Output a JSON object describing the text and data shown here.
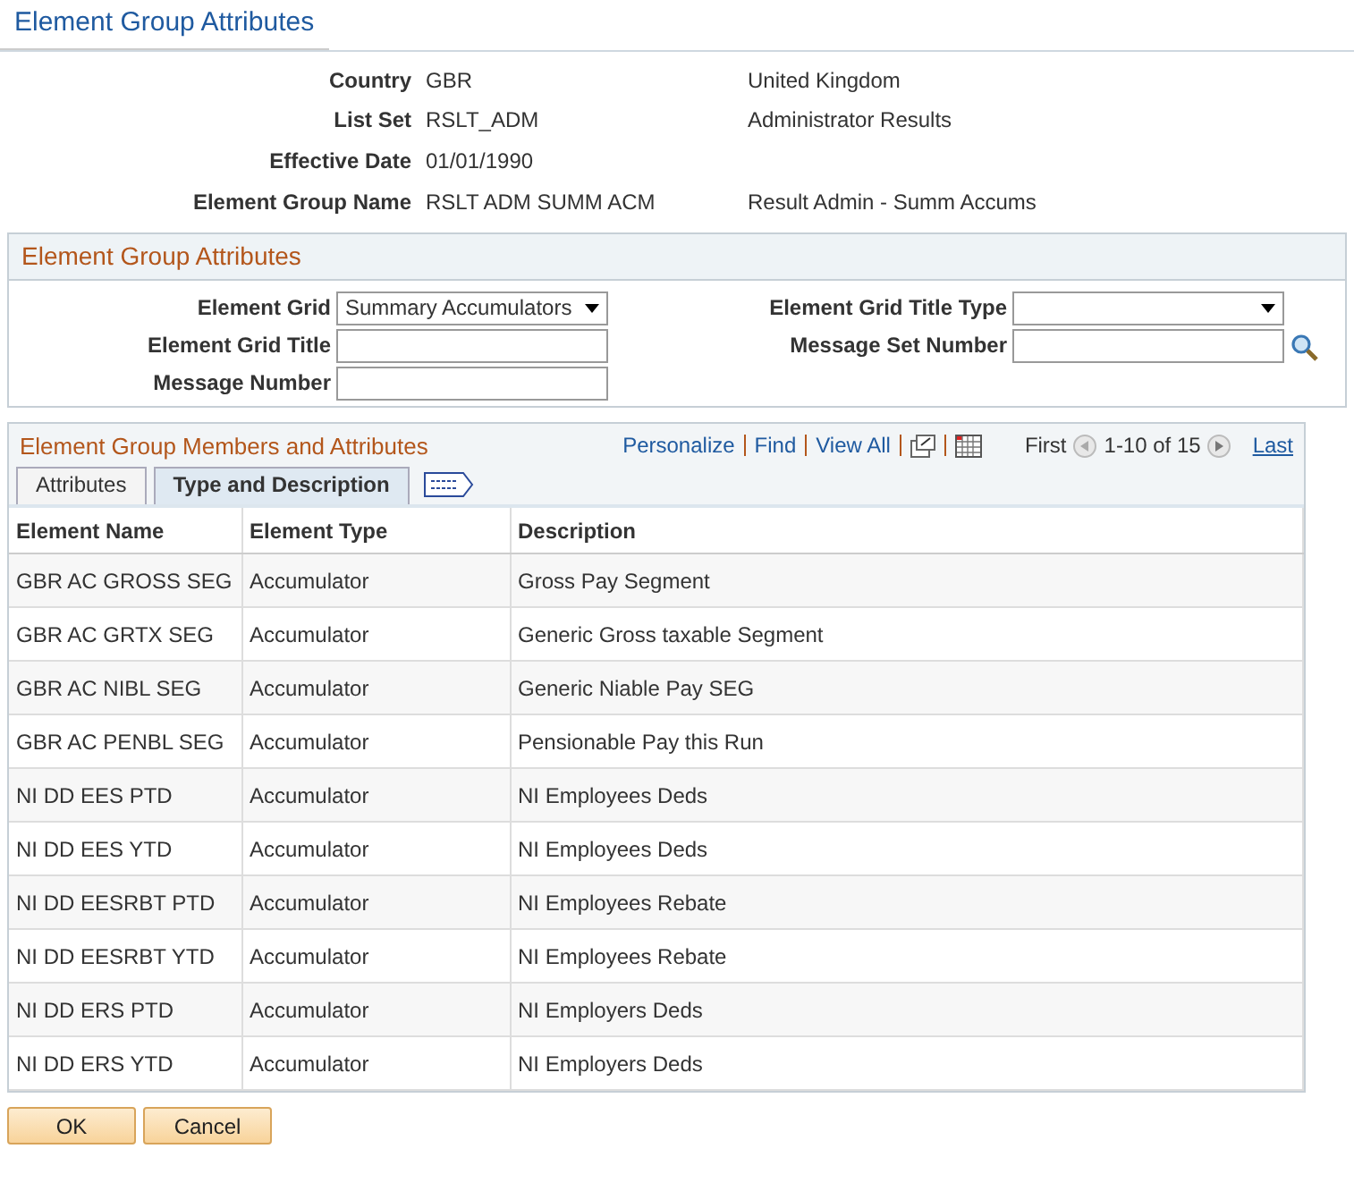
{
  "page_title": "Element Group Attributes",
  "keys": [
    {
      "label": "Country",
      "value": "GBR",
      "description": "United Kingdom"
    },
    {
      "label": "List Set",
      "value": "RSLT_ADM",
      "description": "Administrator Results"
    },
    {
      "label": "Effective Date",
      "value": "01/01/1990"
    },
    {
      "label": "Element Group Name",
      "value": "RSLT ADM SUMM ACM",
      "description": "Result Admin - Summ Accums"
    }
  ],
  "attributes_section": {
    "title": "Element Group Attributes",
    "fields": [
      {
        "label": "Element Grid",
        "kind": "select",
        "value": "Summary Accumulators"
      },
      {
        "label": "Element Grid Title Type",
        "kind": "select"
      },
      {
        "label": "Element Grid Title",
        "kind": "text"
      },
      {
        "label": "Message Set Number",
        "kind": "lookup"
      },
      {
        "label": "Message Number",
        "kind": "text"
      }
    ]
  },
  "members": {
    "title": "Element Group Members and Attributes",
    "links": [
      "Personalize",
      "Find",
      "View All"
    ],
    "pager": {
      "first": {
        "label": "First",
        "disabled": true
      },
      "range": "1-10 of 15",
      "last": {
        "label": "Last",
        "disabled": false
      }
    },
    "tabs": [
      {
        "label": "Attributes",
        "selected": false
      },
      {
        "label": "Type and Description",
        "selected": true
      }
    ],
    "columns": [
      "Element Name",
      "Element Type",
      "Description"
    ],
    "rows": [
      [
        "GBR AC GROSS SEG",
        "Accumulator",
        "Gross Pay Segment"
      ],
      [
        "GBR AC GRTX SEG",
        "Accumulator",
        "Generic Gross taxable Segment"
      ],
      [
        "GBR AC NIBL SEG",
        "Accumulator",
        "Generic Niable Pay SEG"
      ],
      [
        "GBR AC PENBL SEG",
        "Accumulator",
        "Pensionable Pay this Run"
      ],
      [
        "NI DD EES PTD",
        "Accumulator",
        "NI Employees Deds"
      ],
      [
        "NI DD EES YTD",
        "Accumulator",
        "NI Employees Deds"
      ],
      [
        "NI DD EESRBT PTD",
        "Accumulator",
        "NI Employees Rebate"
      ],
      [
        "NI DD EESRBT YTD",
        "Accumulator",
        "NI Employees Rebate"
      ],
      [
        "NI DD ERS PTD",
        "Accumulator",
        "NI Employers Deds"
      ],
      [
        "NI DD ERS YTD",
        "Accumulator",
        "NI Employers Deds"
      ]
    ]
  },
  "buttons": [
    "OK",
    "Cancel"
  ]
}
